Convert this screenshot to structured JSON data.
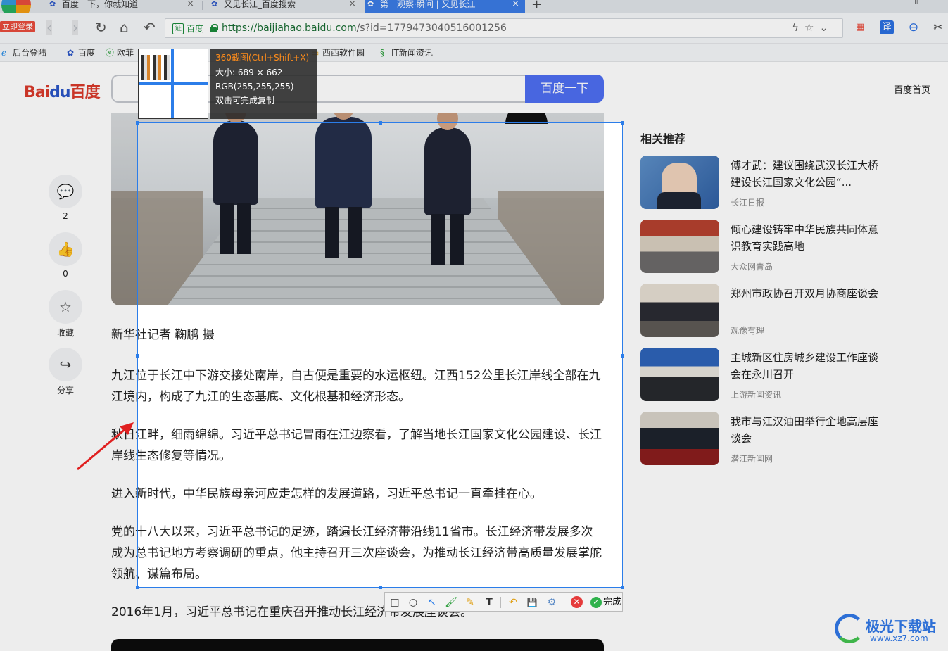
{
  "browser": {
    "login_badge": "立即登录",
    "tabs": [
      {
        "label": "百度一下，你就知道"
      },
      {
        "label": "又见长江_百度搜索"
      },
      {
        "label": "第一观察·瞬间 | 又见长江"
      }
    ],
    "address": {
      "site_badge": "百度",
      "url_host": "https://baijiahao.baidu.com",
      "url_rest": "/s?id=1779473040516001256"
    },
    "bookmarks": [
      {
        "label": "后台登陆",
        "icon": "ie-icon"
      },
      {
        "label": "百度",
        "icon": "paw-icon"
      },
      {
        "label": "欧菲",
        "icon": "e-icon"
      },
      {
        "label": "西西软件园",
        "icon": "folder-icon"
      },
      {
        "label": "IT新闻资讯",
        "icon": "it-icon"
      }
    ],
    "extensions": [
      {
        "name": "windows-icon",
        "glyph": "▦"
      },
      {
        "name": "translate-icon",
        "glyph": "译"
      },
      {
        "name": "minus-icon",
        "glyph": "⊖"
      },
      {
        "name": "scissors-icon",
        "glyph": "✂"
      }
    ]
  },
  "page": {
    "logo": {
      "bai": "Bai",
      "du": "du",
      "cn": "百度"
    },
    "search_button": "百度一下",
    "home_link": "百度首页",
    "actions": [
      {
        "name": "comment",
        "glyph": "💬",
        "label": "2"
      },
      {
        "name": "like",
        "glyph": "👍",
        "label": "0"
      },
      {
        "name": "favorite",
        "glyph": "☆",
        "label": "收藏"
      },
      {
        "name": "share",
        "glyph": "↪",
        "label": "分享"
      }
    ],
    "article": {
      "caption": "新华社记者 鞠鹏 摄",
      "paragraphs": [
        "九江位于长江中下游交接处南岸，自古便是重要的水运枢纽。江西152公里长江岸线全部在九江境内，构成了九江的生态基底、文化根基和经济形态。",
        "秋日江畔，细雨绵绵。习近平总书记冒雨在江边察看，了解当地长江国家文化公园建设、长江岸线生态修复等情况。",
        "进入新时代，中华民族母亲河应走怎样的发展道路，习近平总书记一直牵挂在心。",
        "党的十八大以来，习近平总书记的足迹，踏遍长江经济带沿线11省市。长江经济带发展多次成为总书记地方考察调研的重点，他主持召开三次座谈会，为推动长江经济带高质量发展掌舵领航、谋篇布局。",
        "2016年1月，习近平总书记在重庆召开推动长江经济带发展座谈会。"
      ]
    },
    "recommendations": {
      "title": "相关推荐",
      "items": [
        {
          "title": "傅才武：建议围绕武汉长江大桥建设长江国家文化公园“...",
          "source": "长江日报"
        },
        {
          "title": "倾心建设铸牢中华民族共同体意识教育实践高地",
          "source": "大众网青岛"
        },
        {
          "title": "郑州市政协召开双月协商座谈会",
          "source": "观豫有理"
        },
        {
          "title": "主城新区住房城乡建设工作座谈会在永川召开",
          "source": "上游新闻资讯"
        },
        {
          "title": "我市与江汉油田举行企地高层座谈会",
          "source": "潜江新闻网"
        }
      ]
    }
  },
  "capture": {
    "info_title": "360截图(Ctrl+Shift+X)",
    "size_text": "大小: 689 × 662",
    "rgb_text": "RGB(255,255,255)",
    "hint_text": "双击可完成复制",
    "toolbar": {
      "tools": [
        {
          "name": "rectangle-tool-icon",
          "glyph": "□"
        },
        {
          "name": "ellipse-tool-icon",
          "glyph": "○"
        },
        {
          "name": "arrow-tool-icon",
          "glyph": "↖"
        },
        {
          "name": "brush-tool-icon",
          "glyph": "🖌"
        },
        {
          "name": "highlighter-tool-icon",
          "glyph": "✎"
        },
        {
          "name": "text-tool-icon",
          "glyph": "T"
        },
        {
          "name": "undo-icon",
          "glyph": "↶"
        },
        {
          "name": "save-icon",
          "glyph": "💾"
        },
        {
          "name": "settings-icon",
          "glyph": "⚙"
        }
      ],
      "cancel_glyph": "✕",
      "done_label": "完成",
      "done_glyph": "✓"
    }
  },
  "watermark": {
    "brand": "极光下载站",
    "url": "www.xz7.com"
  },
  "colors": {
    "accent": "#2b7de9",
    "baidu_blue": "#4e6ef2",
    "baidu_red": "#d93a2b",
    "arrow": "#e02020"
  }
}
